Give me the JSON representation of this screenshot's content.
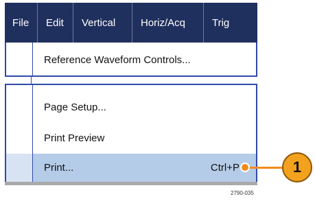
{
  "menubar": {
    "items": [
      "File",
      "Edit",
      "Vertical",
      "Horiz/Acq",
      "Trig"
    ]
  },
  "menu_top": {
    "item": "Reference Waveform Controls..."
  },
  "menu_bottom": {
    "items": [
      "Page Setup...",
      "Print Preview"
    ],
    "print": {
      "label": "Print...",
      "shortcut": "Ctrl+P"
    }
  },
  "callout": {
    "number": "1"
  },
  "figure_id": "2790-035",
  "colors": {
    "menubar": "#20305e",
    "border": "#2f4aa8",
    "highlight": "#b5cce8",
    "callout": "#f08c1c"
  }
}
